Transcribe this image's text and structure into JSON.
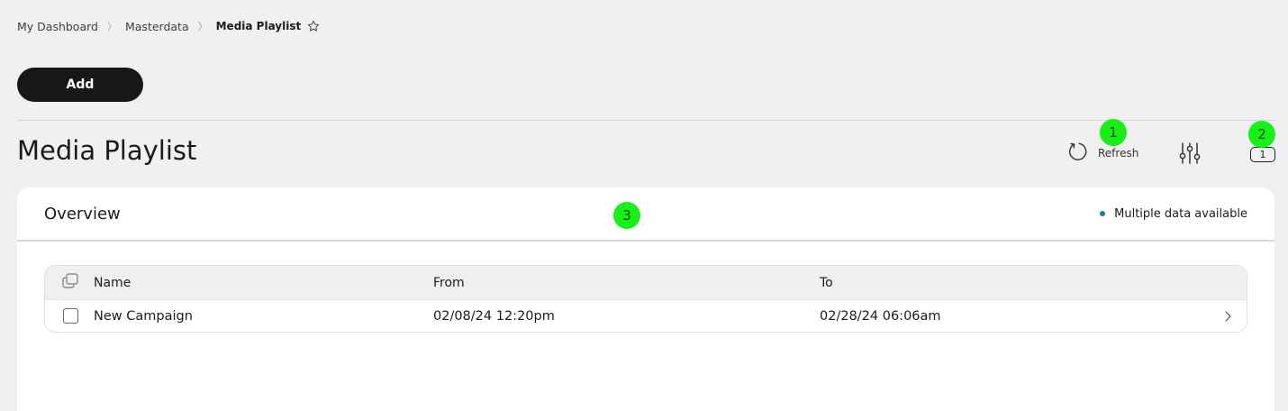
{
  "breadcrumb": {
    "items": [
      "My Dashboard",
      "Masterdata"
    ],
    "current": "Media Playlist",
    "separator": "〉"
  },
  "toolbar": {
    "add_label": "Add"
  },
  "page": {
    "title": "Media Playlist"
  },
  "actions": {
    "refresh_label": "Refresh",
    "count": "1"
  },
  "markers": [
    "1",
    "2",
    "3"
  ],
  "panel": {
    "title": "Overview",
    "status": "Multiple data available"
  },
  "table": {
    "headers": {
      "name": "Name",
      "from": "From",
      "to": "To"
    },
    "rows": [
      {
        "name": "New Campaign",
        "from": "02/08/24 12:20pm",
        "to": "02/28/24 06:06am"
      }
    ]
  },
  "colors": {
    "accent_marker": "#16f016",
    "status_dot": "#1a7b95",
    "button": "#171717"
  },
  "icons": [
    "star-icon",
    "refresh-icon",
    "sliders-icon",
    "copy-icon",
    "chevron-right-icon"
  ]
}
